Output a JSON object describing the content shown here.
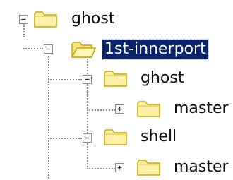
{
  "tree": {
    "root": {
      "label": "ghost",
      "expanded": true,
      "children": [
        {
          "label": "1st-innerport",
          "selected": true,
          "expanded": true,
          "children": [
            {
              "label": "ghost",
              "expanded": true,
              "children": [
                {
                  "label": "master",
                  "expanded": false
                }
              ]
            },
            {
              "label": "shell",
              "expanded": true,
              "children": [
                {
                  "label": "master",
                  "expanded": false
                }
              ]
            }
          ]
        }
      ]
    },
    "colors": {
      "selection_bg": "#0a246a",
      "selection_text": "#ffffff",
      "folder_fill": "#fff0a8",
      "folder_stroke": "#c8a800",
      "connector": "#8c8c8c"
    },
    "icons": {
      "folder": "folder-icon",
      "open_folder": "open-folder-icon",
      "collapse": "minus-box-icon",
      "expand": "plus-box-icon"
    }
  }
}
